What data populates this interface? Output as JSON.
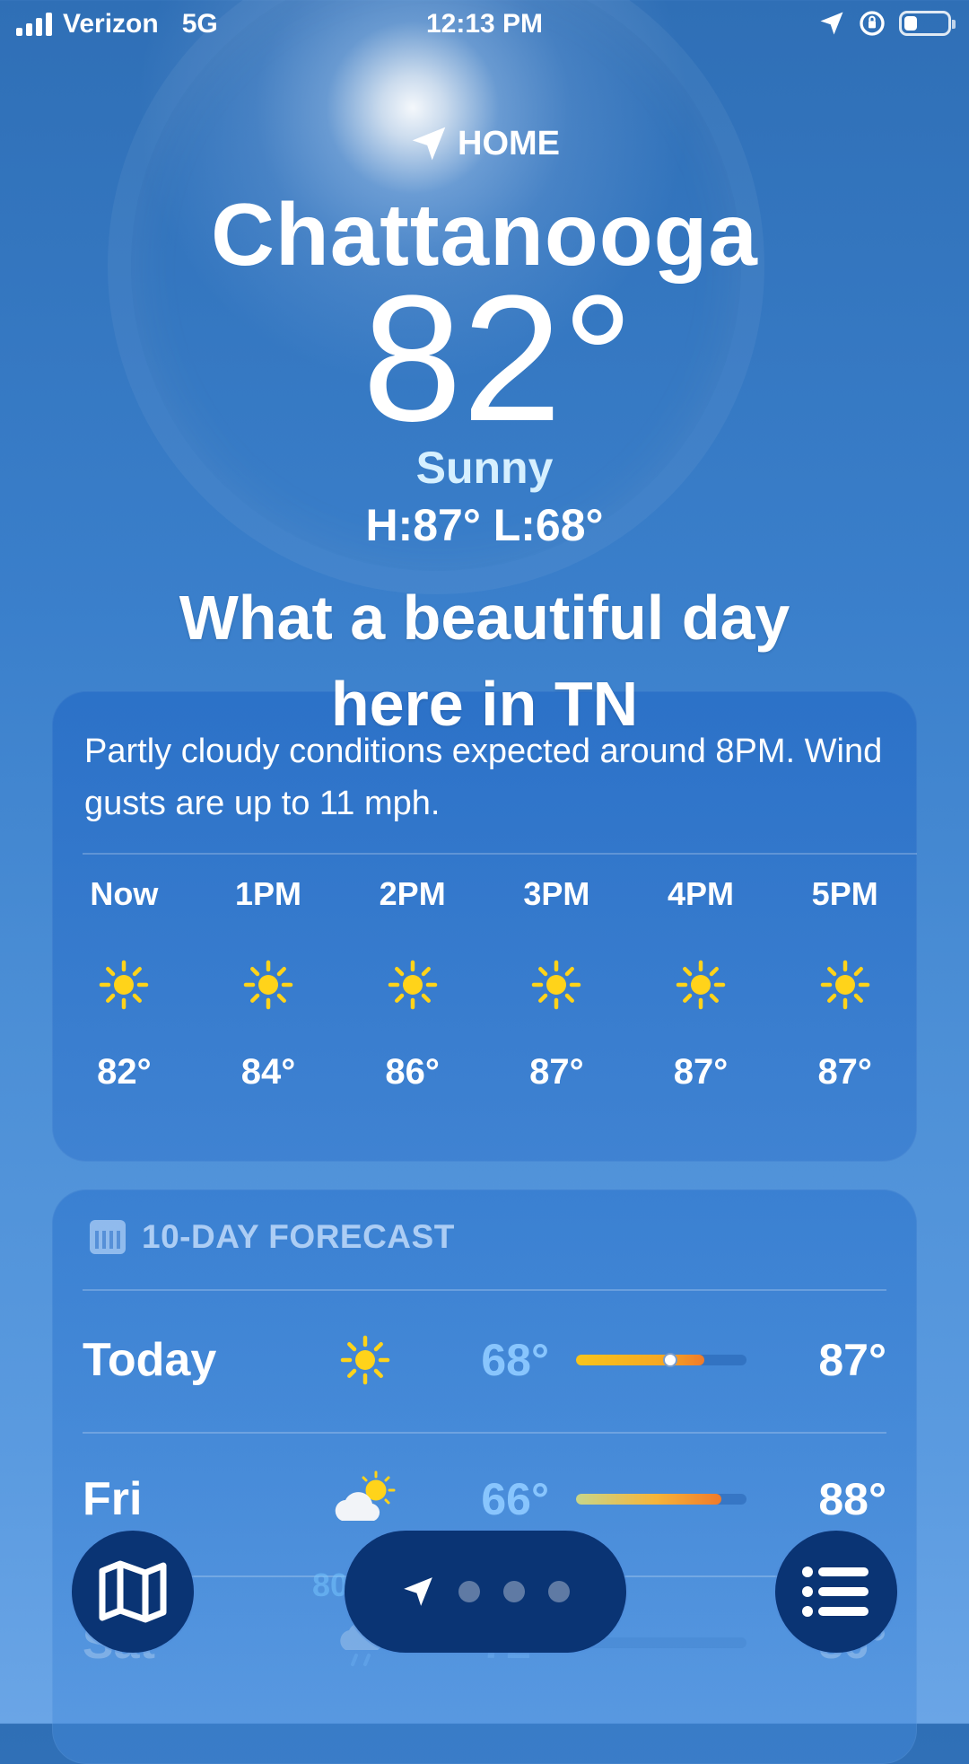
{
  "status_bar": {
    "carrier": "Verizon",
    "network": "5G",
    "time": "12:13 PM"
  },
  "header": {
    "location_label": "HOME",
    "city": "Chattanooga",
    "temperature": "82°",
    "condition": "Sunny",
    "high_low": "H:87°  L:68°"
  },
  "caption": {
    "line1": "What a beautiful day",
    "line2": "here in TN"
  },
  "hourly": {
    "summary": "Partly cloudy conditions expected around 8PM. Wind gusts are up to 11 mph.",
    "hours": [
      {
        "time": "Now",
        "icon": "sun-icon",
        "temp": "82°"
      },
      {
        "time": "1PM",
        "icon": "sun-icon",
        "temp": "84°"
      },
      {
        "time": "2PM",
        "icon": "sun-icon",
        "temp": "86°"
      },
      {
        "time": "3PM",
        "icon": "sun-icon",
        "temp": "87°"
      },
      {
        "time": "4PM",
        "icon": "sun-icon",
        "temp": "87°"
      },
      {
        "time": "5PM",
        "icon": "sun-icon",
        "temp": "87°"
      }
    ]
  },
  "ten_day": {
    "title": "10-DAY FORECAST",
    "days": [
      {
        "day": "Today",
        "icon": "sun-icon",
        "low": "68°",
        "high": "87°",
        "range_start": 0.0,
        "range_end": 0.75,
        "current_marker": 0.55
      },
      {
        "day": "Fri",
        "icon": "partly-cloudy-icon",
        "low": "66°",
        "high": "88°",
        "range_start": 0.0,
        "range_end": 0.85
      },
      {
        "day": "Sat",
        "icon": "rain-icon",
        "precip": "80%",
        "low": "72°",
        "high": "86°"
      }
    ]
  },
  "toolbar": {
    "page_count": 4,
    "current_page": 0
  },
  "colors": {
    "sun": "#FFD31A",
    "bar_warm": "#F5A623",
    "bar_hot": "#F07A2A",
    "toolbar": "#0A3474"
  }
}
